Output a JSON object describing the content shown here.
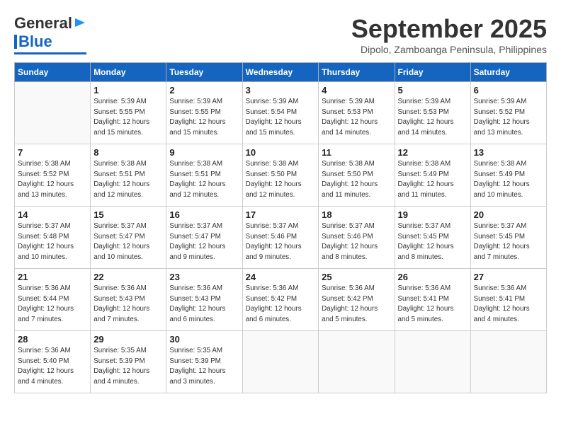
{
  "header": {
    "logo_line1": "General",
    "logo_line2": "Blue",
    "month_title": "September 2025",
    "subtitle": "Dipolo, Zamboanga Peninsula, Philippines"
  },
  "days_of_week": [
    "Sunday",
    "Monday",
    "Tuesday",
    "Wednesday",
    "Thursday",
    "Friday",
    "Saturday"
  ],
  "weeks": [
    [
      {
        "day": "",
        "info": ""
      },
      {
        "day": "1",
        "info": "Sunrise: 5:39 AM\nSunset: 5:55 PM\nDaylight: 12 hours\nand 15 minutes."
      },
      {
        "day": "2",
        "info": "Sunrise: 5:39 AM\nSunset: 5:55 PM\nDaylight: 12 hours\nand 15 minutes."
      },
      {
        "day": "3",
        "info": "Sunrise: 5:39 AM\nSunset: 5:54 PM\nDaylight: 12 hours\nand 15 minutes."
      },
      {
        "day": "4",
        "info": "Sunrise: 5:39 AM\nSunset: 5:53 PM\nDaylight: 12 hours\nand 14 minutes."
      },
      {
        "day": "5",
        "info": "Sunrise: 5:39 AM\nSunset: 5:53 PM\nDaylight: 12 hours\nand 14 minutes."
      },
      {
        "day": "6",
        "info": "Sunrise: 5:39 AM\nSunset: 5:52 PM\nDaylight: 12 hours\nand 13 minutes."
      }
    ],
    [
      {
        "day": "7",
        "info": "Sunrise: 5:38 AM\nSunset: 5:52 PM\nDaylight: 12 hours\nand 13 minutes."
      },
      {
        "day": "8",
        "info": "Sunrise: 5:38 AM\nSunset: 5:51 PM\nDaylight: 12 hours\nand 12 minutes."
      },
      {
        "day": "9",
        "info": "Sunrise: 5:38 AM\nSunset: 5:51 PM\nDaylight: 12 hours\nand 12 minutes."
      },
      {
        "day": "10",
        "info": "Sunrise: 5:38 AM\nSunset: 5:50 PM\nDaylight: 12 hours\nand 12 minutes."
      },
      {
        "day": "11",
        "info": "Sunrise: 5:38 AM\nSunset: 5:50 PM\nDaylight: 12 hours\nand 11 minutes."
      },
      {
        "day": "12",
        "info": "Sunrise: 5:38 AM\nSunset: 5:49 PM\nDaylight: 12 hours\nand 11 minutes."
      },
      {
        "day": "13",
        "info": "Sunrise: 5:38 AM\nSunset: 5:49 PM\nDaylight: 12 hours\nand 10 minutes."
      }
    ],
    [
      {
        "day": "14",
        "info": "Sunrise: 5:37 AM\nSunset: 5:48 PM\nDaylight: 12 hours\nand 10 minutes."
      },
      {
        "day": "15",
        "info": "Sunrise: 5:37 AM\nSunset: 5:47 PM\nDaylight: 12 hours\nand 10 minutes."
      },
      {
        "day": "16",
        "info": "Sunrise: 5:37 AM\nSunset: 5:47 PM\nDaylight: 12 hours\nand 9 minutes."
      },
      {
        "day": "17",
        "info": "Sunrise: 5:37 AM\nSunset: 5:46 PM\nDaylight: 12 hours\nand 9 minutes."
      },
      {
        "day": "18",
        "info": "Sunrise: 5:37 AM\nSunset: 5:46 PM\nDaylight: 12 hours\nand 8 minutes."
      },
      {
        "day": "19",
        "info": "Sunrise: 5:37 AM\nSunset: 5:45 PM\nDaylight: 12 hours\nand 8 minutes."
      },
      {
        "day": "20",
        "info": "Sunrise: 5:37 AM\nSunset: 5:45 PM\nDaylight: 12 hours\nand 7 minutes."
      }
    ],
    [
      {
        "day": "21",
        "info": "Sunrise: 5:36 AM\nSunset: 5:44 PM\nDaylight: 12 hours\nand 7 minutes."
      },
      {
        "day": "22",
        "info": "Sunrise: 5:36 AM\nSunset: 5:43 PM\nDaylight: 12 hours\nand 7 minutes."
      },
      {
        "day": "23",
        "info": "Sunrise: 5:36 AM\nSunset: 5:43 PM\nDaylight: 12 hours\nand 6 minutes."
      },
      {
        "day": "24",
        "info": "Sunrise: 5:36 AM\nSunset: 5:42 PM\nDaylight: 12 hours\nand 6 minutes."
      },
      {
        "day": "25",
        "info": "Sunrise: 5:36 AM\nSunset: 5:42 PM\nDaylight: 12 hours\nand 5 minutes."
      },
      {
        "day": "26",
        "info": "Sunrise: 5:36 AM\nSunset: 5:41 PM\nDaylight: 12 hours\nand 5 minutes."
      },
      {
        "day": "27",
        "info": "Sunrise: 5:36 AM\nSunset: 5:41 PM\nDaylight: 12 hours\nand 4 minutes."
      }
    ],
    [
      {
        "day": "28",
        "info": "Sunrise: 5:36 AM\nSunset: 5:40 PM\nDaylight: 12 hours\nand 4 minutes."
      },
      {
        "day": "29",
        "info": "Sunrise: 5:35 AM\nSunset: 5:39 PM\nDaylight: 12 hours\nand 4 minutes."
      },
      {
        "day": "30",
        "info": "Sunrise: 5:35 AM\nSunset: 5:39 PM\nDaylight: 12 hours\nand 3 minutes."
      },
      {
        "day": "",
        "info": ""
      },
      {
        "day": "",
        "info": ""
      },
      {
        "day": "",
        "info": ""
      },
      {
        "day": "",
        "info": ""
      }
    ]
  ]
}
